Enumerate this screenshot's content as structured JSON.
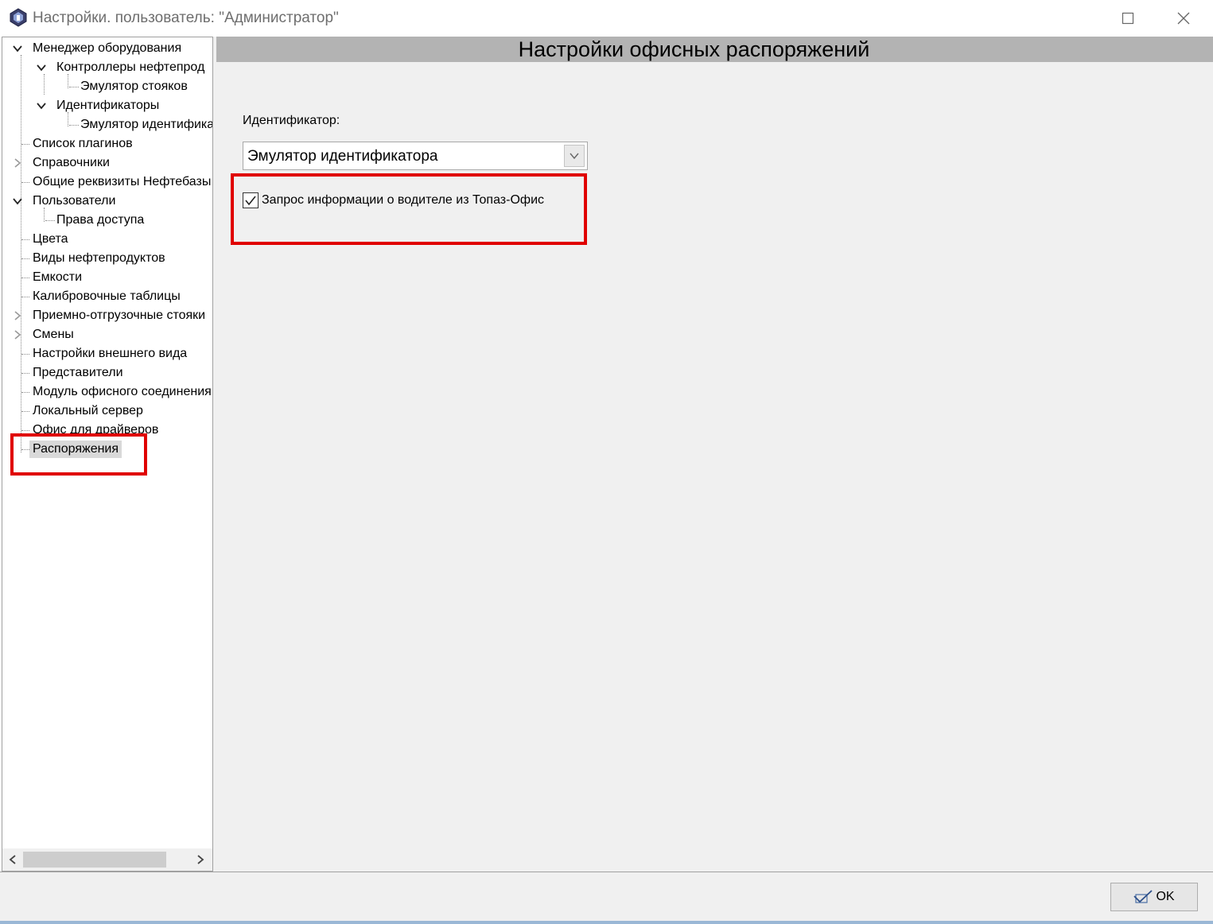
{
  "window": {
    "title": "Настройки. пользователь: \"Администратор\""
  },
  "tree": {
    "items": [
      {
        "label": "Менеджер оборудования"
      },
      {
        "label": "Контроллеры нефтепрод"
      },
      {
        "label": "Эмулятор стояков"
      },
      {
        "label": "Идентификаторы"
      },
      {
        "label": "Эмулятор идентифика"
      },
      {
        "label": "Список плагинов"
      },
      {
        "label": "Справочники"
      },
      {
        "label": "Общие реквизиты Нефтебазы"
      },
      {
        "label": "Пользователи"
      },
      {
        "label": "Права доступа"
      },
      {
        "label": "Цвета"
      },
      {
        "label": "Виды нефтепродуктов"
      },
      {
        "label": "Емкости"
      },
      {
        "label": "Калибровочные таблицы"
      },
      {
        "label": "Приемно-отгрузочные стояки"
      },
      {
        "label": "Смены"
      },
      {
        "label": "Настройки внешнего вида"
      },
      {
        "label": "Представители"
      },
      {
        "label": "Модуль офисного соединения"
      },
      {
        "label": "Локальный сервер"
      },
      {
        "label": "Офис для драйверов"
      },
      {
        "label": "Распоряжения"
      }
    ]
  },
  "content": {
    "header_title": "Настройки офисных распоряжений",
    "identifier_label": "Идентификатор:",
    "identifier_value": "Эмулятор идентификатора",
    "driver_info_checkbox": {
      "label": "Запрос информации о водителе из Топаз-Офис",
      "checked": true
    }
  },
  "footer": {
    "ok_label": "OK"
  },
  "colors": {
    "highlight": "#e00000",
    "header_bar": "#b3b3b3",
    "panel_bg": "#f0f0f0",
    "selected_bg": "#d9d9d9"
  },
  "icons": [
    "app-icon",
    "minimize-icon",
    "maximize-icon",
    "close-icon",
    "chevron-down-icon",
    "chevron-right-icon",
    "checkmark-icon",
    "ok-check-icon"
  ]
}
